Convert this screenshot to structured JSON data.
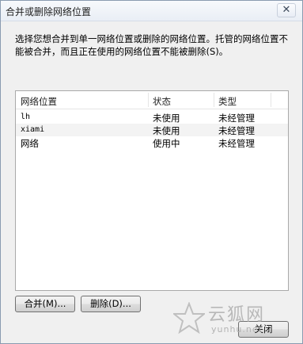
{
  "window": {
    "title": "合并或删除网络位置",
    "close_glyph": "✕"
  },
  "description": "选择您想合并到单一网络位置或删除的网络位置。托管的网络位置不能被合并，而且正在使用的网络位置不能被删除(S)。",
  "list": {
    "columns": [
      "网络位置",
      "状态",
      "类型"
    ],
    "rows": [
      {
        "name": "lh",
        "status": "未使用",
        "type": "未经管理"
      },
      {
        "name": "xiami",
        "status": "未使用",
        "type": "未经管理"
      },
      {
        "name": "网络",
        "status": "使用中",
        "type": "未经管理"
      }
    ]
  },
  "buttons": {
    "merge": "合并(M)...",
    "delete": "删除(D)...",
    "close": "关闭"
  },
  "watermark": {
    "text": "云狐网",
    "url": "yunhu.net"
  }
}
